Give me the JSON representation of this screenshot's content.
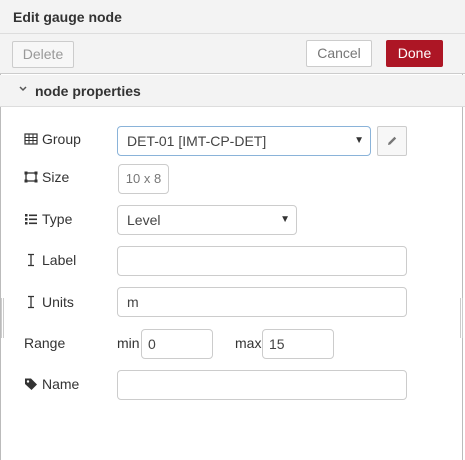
{
  "dialog": {
    "title": "Edit gauge node",
    "delete_label": "Delete",
    "cancel_label": "Cancel",
    "done_label": "Done",
    "accent_color": "#ad1625"
  },
  "section": {
    "title": "node properties",
    "toggle_icon": "chevron-down-icon"
  },
  "form": {
    "group": {
      "label": "Group",
      "icon": "table-icon",
      "value": "DET-01 [IMT-CP-DET]"
    },
    "size": {
      "label": "Size",
      "icon": "resize-icon",
      "value": "10 x 8"
    },
    "type": {
      "label": "Type",
      "icon": "list-icon",
      "value": "Level"
    },
    "label_field": {
      "label": "Label",
      "icon": "text-cursor-icon",
      "value": ""
    },
    "units": {
      "label": "Units",
      "icon": "text-cursor-icon",
      "value": "m"
    },
    "range": {
      "label": "Range",
      "min_label": "min",
      "min_value": "0",
      "max_label": "max",
      "max_value": "15"
    },
    "name": {
      "label": "Name",
      "icon": "tag-icon",
      "value": ""
    }
  }
}
